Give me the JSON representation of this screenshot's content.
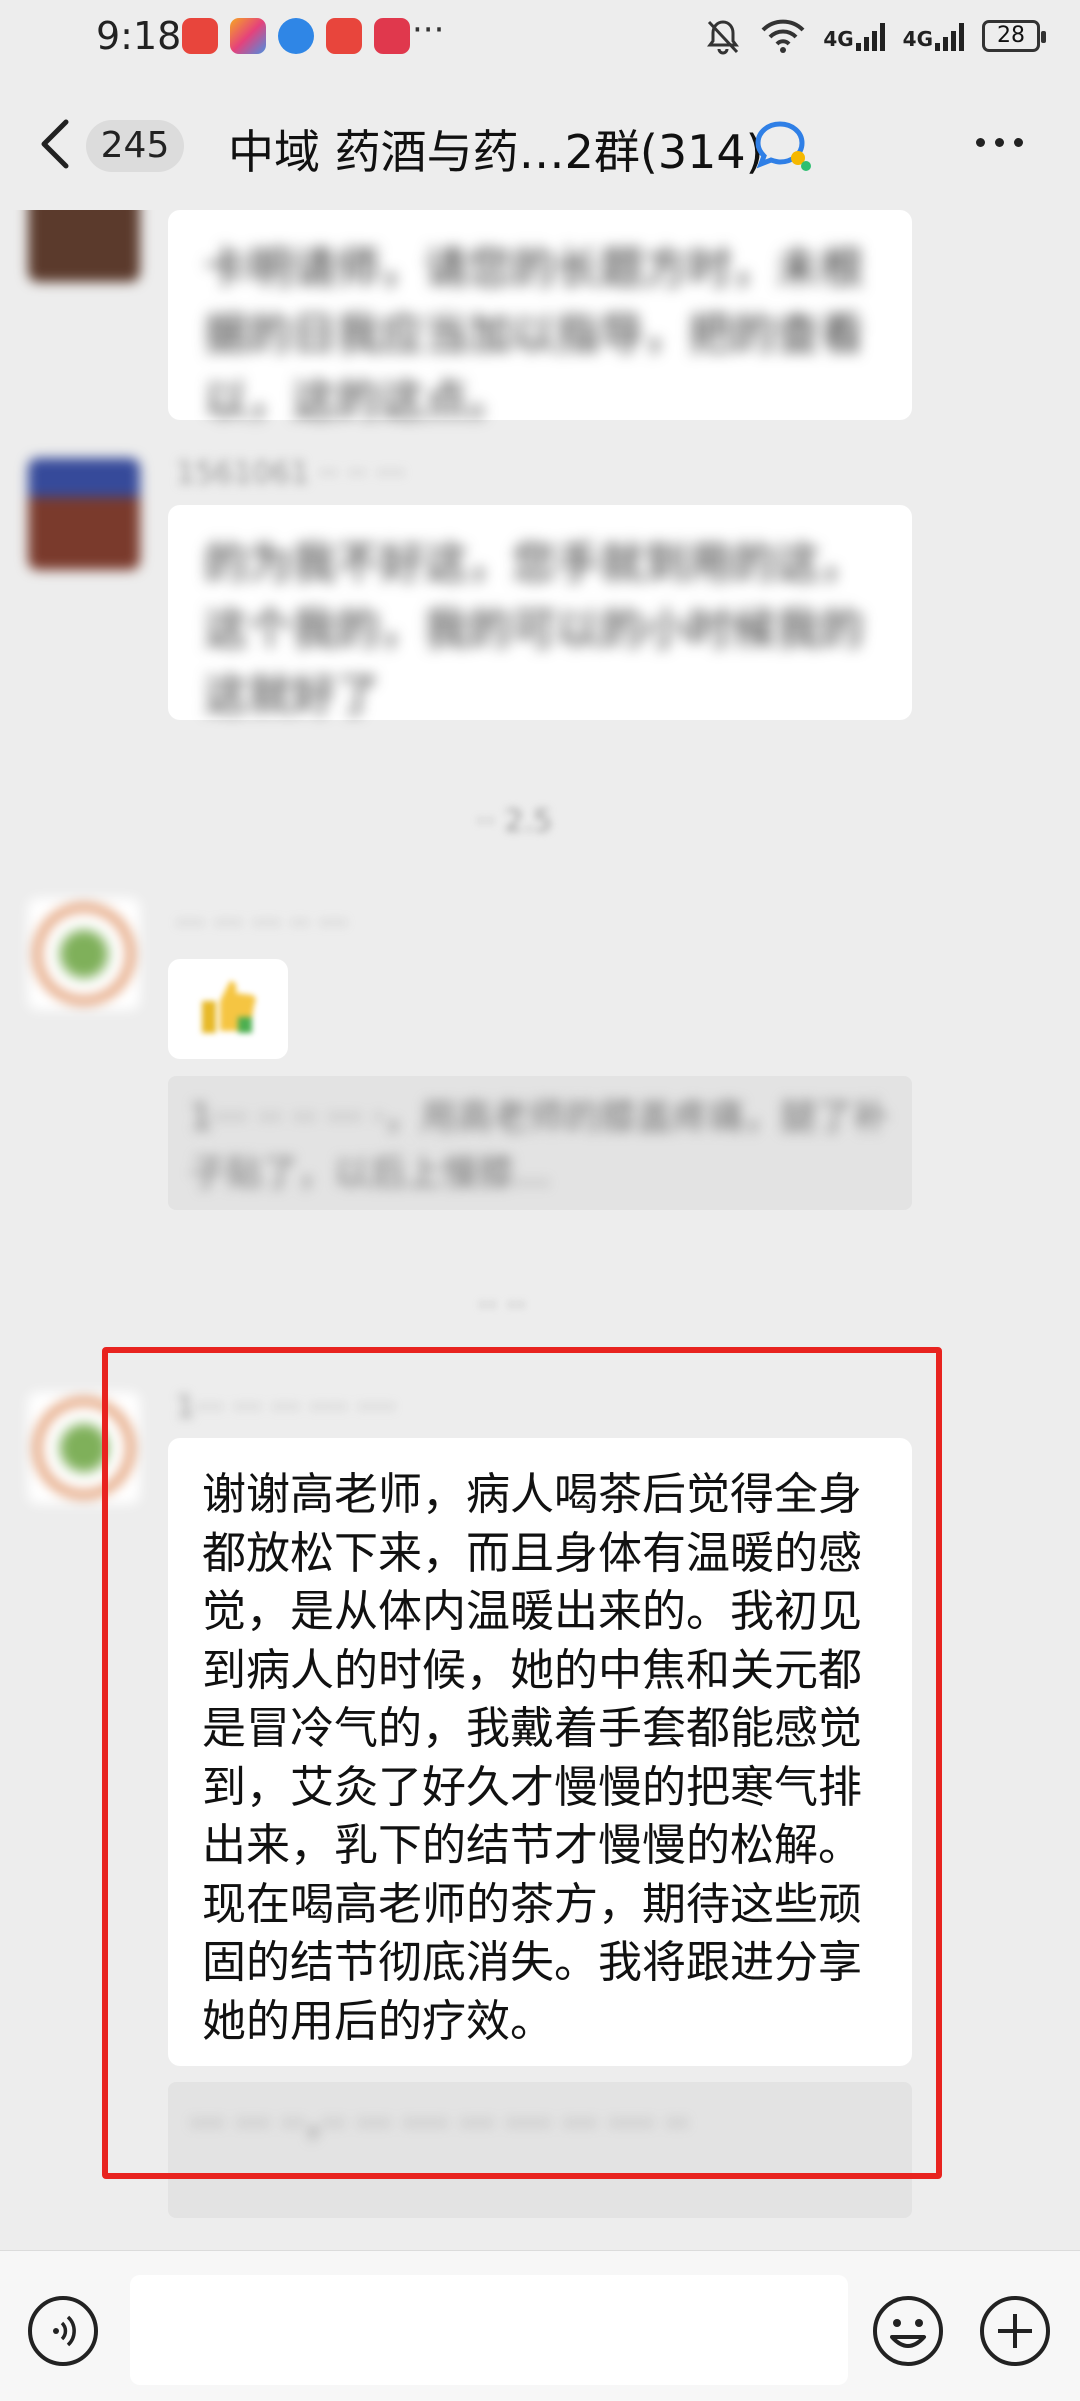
{
  "status_bar": {
    "time": "9:18",
    "overflow": "···",
    "network_1": "4G",
    "network_2": "4G",
    "battery": "28"
  },
  "header": {
    "back_icon": "chevron-left-icon",
    "unread_count": "245",
    "title": "中域 药酒与药…2群(314)",
    "group_icon": "group-chat-icon",
    "more_icon": "more-dots-icon"
  },
  "messages": {
    "time_divider_1": "·· 2.5",
    "time_divider_2": "·· ··",
    "main_message": "谢谢高老师，病人喝茶后觉得全身\n都放松下来，而且身体有温暖的感\n觉，是从体内温暖出来的。我初见\n到病人的时候，她的中焦和关元都\n是冒冷气的，我戴着手套都能感觉\n到，艾灸了好久才慢慢的把寒气排\n出来，乳下的结节才慢慢的松解。\n现在喝高老师的茶方，期待这些顽\n固的结节彻底消失。我将跟进分享\n她的用后的疗效。",
    "thumbs_icon": "thumbs-up-icon"
  },
  "input_bar": {
    "voice_icon": "voice-icon",
    "emoji_icon": "emoji-icon",
    "plus_icon": "plus-icon",
    "placeholder": ""
  },
  "colors": {
    "highlight_border": "#e8231f",
    "background": "#ededed",
    "bubble": "#ffffff"
  }
}
